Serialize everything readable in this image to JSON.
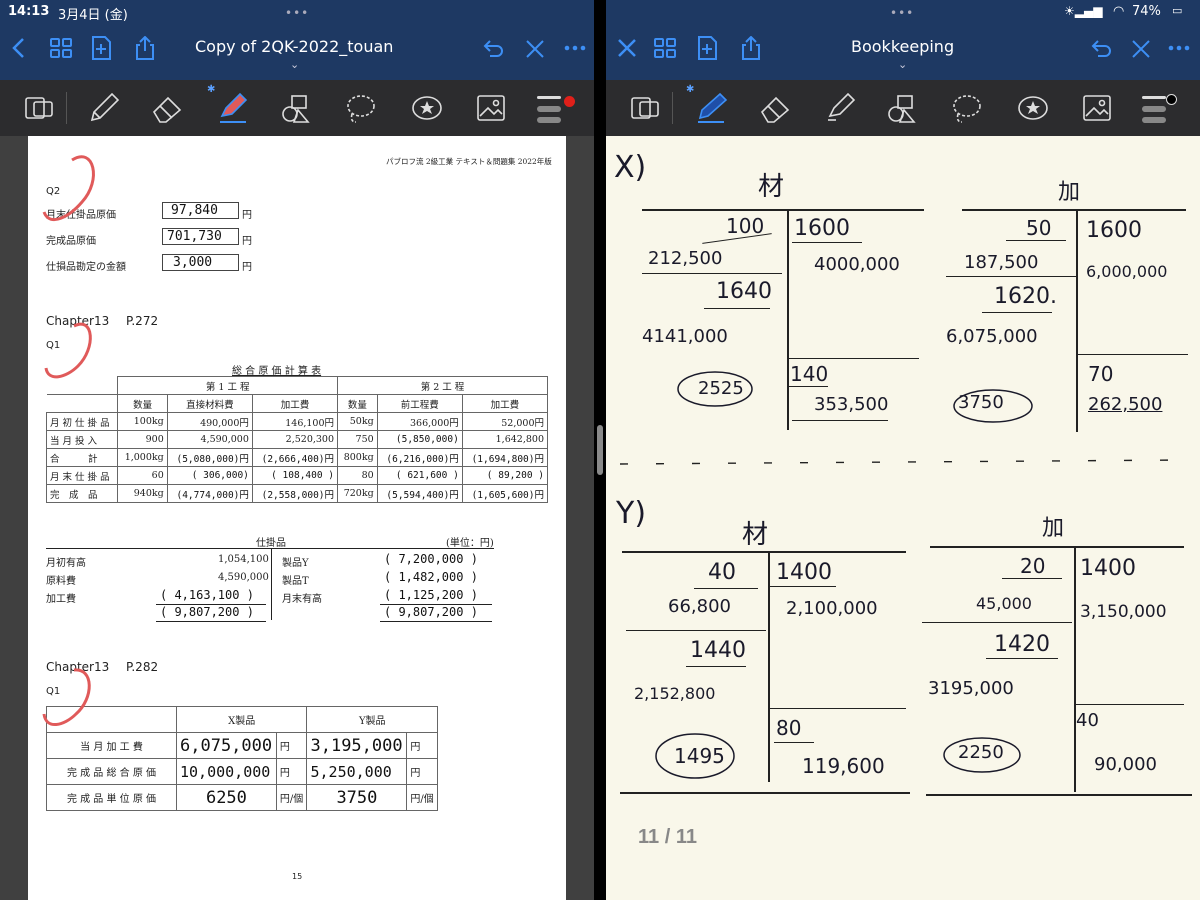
{
  "status": {
    "time": "14:13",
    "date": "3月4日 (金)",
    "battery": "74%"
  },
  "colors": {
    "nav_bg": "#1e3963",
    "accent": "#3d8ff5",
    "toolbar": "#2c2c2e",
    "pen_red": "#e05a5a",
    "paper_right": "#f9f7ea"
  },
  "left": {
    "title": "Copy of 2QK-2022_touan",
    "header_note": "パブロフ流 2級工業 テキスト＆問題集 2022年版",
    "q2": {
      "label": "Q2",
      "rows": [
        {
          "label": "月末仕掛品原価",
          "value": "97,840",
          "unit": "円"
        },
        {
          "label": "完成品原価",
          "value": "701,730",
          "unit": "円"
        },
        {
          "label": "仕損品勘定の金額",
          "value": "3,000",
          "unit": "円"
        }
      ]
    },
    "ch13_272": {
      "heading": "Chapter13",
      "page": "P.272",
      "q": "Q1",
      "table_title": "総 合 原 価 計 算 表",
      "proc1": "第 1 工 程",
      "proc2": "第 2 工 程",
      "cols": [
        "数量",
        "直接材料費",
        "加工費",
        "数量",
        "前工程費",
        "加工費"
      ],
      "rows": [
        [
          "月 初 仕 掛 品",
          "100kg",
          "490,000円",
          "146,100円",
          "50kg",
          "366,000円",
          "52,000円"
        ],
        [
          "当 月 投 入",
          "900",
          "4,590,000",
          "2,520,300",
          "750",
          "(5,850,000)",
          "1,642,800"
        ],
        [
          "合　　　計",
          "1,000kg",
          "(5,080,000)円",
          "(2,666,400)円",
          "800kg",
          "(6,216,000)円",
          "(1,694,800)円"
        ],
        [
          "月 末 仕 掛 品",
          "60",
          "( 306,000)",
          "( 108,400 )",
          "80",
          "( 621,600 )",
          "( 89,200 )"
        ],
        [
          "完　成　品",
          "940kg",
          "(4,774,000)円",
          "(2,558,000)円",
          "720kg",
          "(5,594,400)円",
          "(1,605,600)円"
        ]
      ],
      "ledger": {
        "title": "仕掛品",
        "unit": "(単位：円)",
        "left": [
          [
            "月初有高",
            "1,054,100"
          ],
          [
            "原料費",
            "4,590,000"
          ],
          [
            "加工費",
            "( 4,163,100 )"
          ],
          [
            "",
            "( 9,807,200 )"
          ]
        ],
        "right": [
          [
            "製品Y",
            "( 7,200,000 )"
          ],
          [
            "製品T",
            "( 1,482,000 )"
          ],
          [
            "月末有高",
            "( 1,125,200 )"
          ],
          [
            "",
            "( 9,807,200 )"
          ]
        ]
      }
    },
    "ch13_282": {
      "heading": "Chapter13",
      "page": "P.282",
      "q": "Q1",
      "cols": [
        "X製品",
        "Y製品"
      ],
      "rows": [
        [
          "当 月 加 工 費",
          "6,075,000",
          "円",
          "3,195,000",
          "円"
        ],
        [
          "完 成 品 総 合 原 価",
          "10,000,000",
          "円",
          "5,250,000",
          "円"
        ],
        [
          "完 成 品 単 位 原 価",
          "6250",
          "円/個",
          "3750",
          "円/個"
        ]
      ]
    },
    "page_footer": "15"
  },
  "right": {
    "title": "Bookkeeping",
    "page_indicator": "11 / 11",
    "x": {
      "label": "X)",
      "zai": {
        "head": "材",
        "a": "100",
        "b": "212,500",
        "c": "1640",
        "d": "4141,000",
        "circle": "2525",
        "r1": "1600",
        "r2": "4000,000",
        "r3": "140",
        "r4": "353,500"
      },
      "ka": {
        "head": "加",
        "a": "50",
        "b": "187,500",
        "c": "1620.",
        "d": "6,075,000",
        "circle": "3750",
        "r1": "1600",
        "r2": "6,000,000",
        "r3": "70",
        "r4": "262,500"
      }
    },
    "y": {
      "label": "Y)",
      "zai": {
        "head": "材",
        "a": "40",
        "b": "66,800",
        "c": "1440",
        "d": "2,152,800",
        "circle": "1495",
        "r1": "1400",
        "r2": "2,100,000",
        "r3": "80",
        "r4": "119,600"
      },
      "ka": {
        "head": "加",
        "a": "20",
        "b": "45,000",
        "c": "1420",
        "d": "3195,000",
        "circle": "2250",
        "r1": "1400",
        "r2": "3,150,000",
        "r3": "40",
        "r4": "90,000"
      }
    }
  }
}
